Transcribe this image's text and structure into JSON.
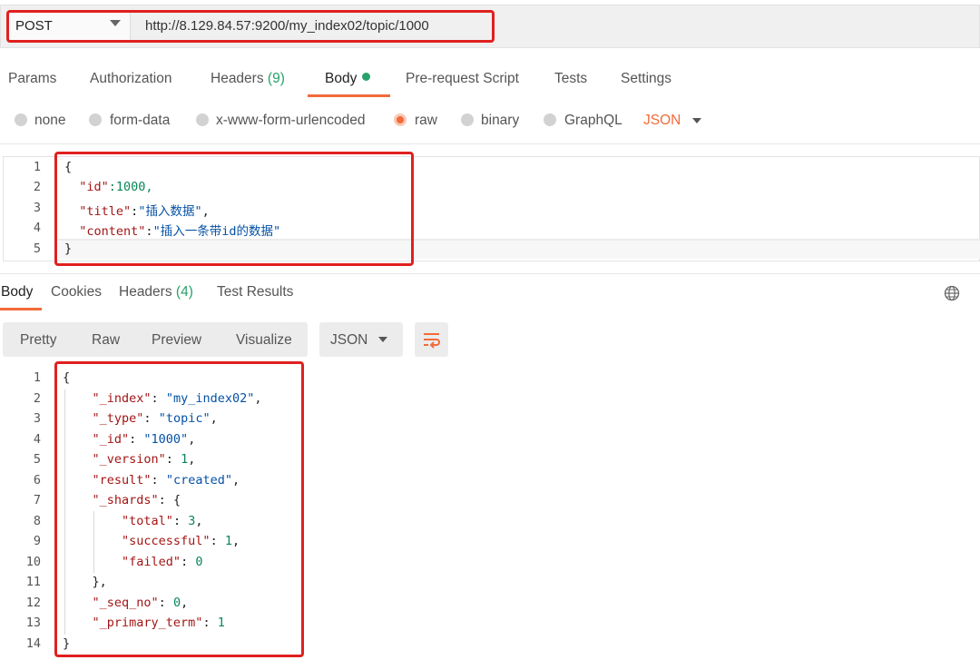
{
  "request": {
    "method": "POST",
    "url": "http://8.129.84.57:9200/my_index02/topic/1000"
  },
  "request_tabs": {
    "params": "Params",
    "authorization": "Authorization",
    "headers": "Headers",
    "headers_count": "(9)",
    "body": "Body",
    "prerequest": "Pre-request Script",
    "tests": "Tests",
    "settings": "Settings"
  },
  "body_types": {
    "none": "none",
    "form_data": "form-data",
    "urlencoded": "x-www-form-urlencoded",
    "raw": "raw",
    "binary": "binary",
    "graphql": "GraphQL",
    "format": "JSON"
  },
  "request_body": {
    "line_numbers": [
      "1",
      "2",
      "3",
      "4",
      "5"
    ],
    "l1": "{",
    "l2_key": "\"id\"",
    "l2_rest": ":1000,",
    "l3_key": "\"title\"",
    "l3_colon": ":",
    "l3_val": "\"插入数据\"",
    "l3_end": ",",
    "l4_key": "\"content\"",
    "l4_colon": ":",
    "l4_val": "\"插入一条带id的数据\"",
    "l5": "}"
  },
  "response_tabs": {
    "body": "Body",
    "cookies": "Cookies",
    "headers": "Headers",
    "headers_count": "(4)",
    "test_results": "Test Results"
  },
  "response_toolbar": {
    "pretty": "Pretty",
    "raw": "Raw",
    "preview": "Preview",
    "visualize": "Visualize",
    "format": "JSON"
  },
  "response_body": {
    "line_numbers": [
      "1",
      "2",
      "3",
      "4",
      "5",
      "6",
      "7",
      "8",
      "9",
      "10",
      "11",
      "12",
      "13",
      "14"
    ],
    "open": "{",
    "index_key": "\"_index\"",
    "index_val": "\"my_index02\"",
    "type_key": "\"_type\"",
    "type_val": "\"topic\"",
    "id_key": "\"_id\"",
    "id_val": "\"1000\"",
    "version_key": "\"_version\"",
    "version_val": "1",
    "result_key": "\"result\"",
    "result_val": "\"created\"",
    "shards_key": "\"_shards\"",
    "shards_open": "{",
    "total_key": "\"total\"",
    "total_val": "3",
    "successful_key": "\"successful\"",
    "successful_val": "1",
    "failed_key": "\"failed\"",
    "failed_val": "0",
    "shards_close": "},",
    "seq_key": "\"_seq_no\"",
    "seq_val": "0",
    "term_key": "\"_primary_term\"",
    "term_val": "1",
    "close": "}"
  },
  "icons": {
    "method_dropdown": "chevron-down-icon",
    "globe": "globe-icon",
    "wrap": "wrap-lines-icon"
  },
  "colors": {
    "accent": "#f26b3a",
    "highlight_box": "#e0201f",
    "count_green": "#27a26a"
  }
}
